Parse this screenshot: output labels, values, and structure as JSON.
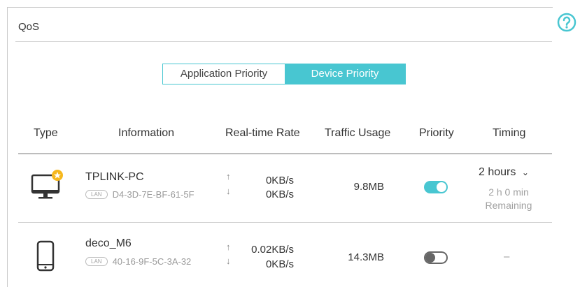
{
  "header": {
    "title": "QoS",
    "help_icon": "question-circle-icon",
    "accent": "#48c6d1"
  },
  "tabs": [
    {
      "label": "Application Priority",
      "active": false
    },
    {
      "label": "Device Priority",
      "active": true
    }
  ],
  "table": {
    "columns": [
      "Type",
      "Information",
      "Real-time Rate",
      "Traffic Usage",
      "Priority",
      "Timing"
    ],
    "rows": [
      {
        "type_icon": "desktop-pc-star-icon",
        "name": "TPLINK-PC",
        "connection": "LAN",
        "mac": "D4-3D-7E-BF-61-5F",
        "upload": "0KB/s",
        "download": "0KB/s",
        "usage": "9.8MB",
        "priority": true,
        "timing": "2 hours",
        "timing_remaining_1": "2 h 0 min",
        "timing_remaining_2": "Remaining"
      },
      {
        "type_icon": "phone-icon",
        "name": "deco_M6",
        "connection": "LAN",
        "mac": "40-16-9F-5C-3A-32",
        "upload": "0.02KB/s",
        "download": "0KB/s",
        "usage": "14.3MB",
        "priority": false,
        "timing": "–"
      }
    ]
  }
}
